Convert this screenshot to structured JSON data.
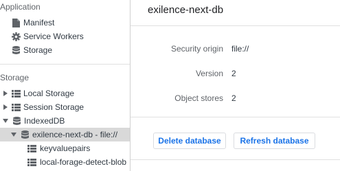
{
  "sidebar": {
    "application": {
      "title": "Application",
      "items": [
        {
          "label": "Manifest",
          "icon": "document-icon"
        },
        {
          "label": "Service Workers",
          "icon": "gear-icon"
        },
        {
          "label": "Storage",
          "icon": "database-icon"
        }
      ]
    },
    "storage": {
      "title": "Storage",
      "items": [
        {
          "label": "Local Storage",
          "icon": "grid-icon",
          "expanded": false
        },
        {
          "label": "Session Storage",
          "icon": "grid-icon",
          "expanded": false
        },
        {
          "label": "IndexedDB",
          "icon": "database-icon",
          "expanded": true
        },
        {
          "label": "exilence-next-db - file://",
          "icon": "database-icon",
          "expanded": true,
          "selected": true
        },
        {
          "label": "keyvaluepairs",
          "icon": "grid-icon"
        },
        {
          "label": "local-forage-detect-blob",
          "icon": "grid-icon"
        }
      ]
    }
  },
  "main": {
    "db_name": "exilence-next-db",
    "fields": [
      {
        "label": "Security origin",
        "value": "file://"
      },
      {
        "label": "Version",
        "value": "2"
      },
      {
        "label": "Object stores",
        "value": "2"
      }
    ],
    "buttons": {
      "delete_label": "Delete database",
      "refresh_label": "Refresh database"
    }
  },
  "colors": {
    "accent": "#1a73e8",
    "selection": "#d9d9d9",
    "icon": "#5f6368"
  }
}
